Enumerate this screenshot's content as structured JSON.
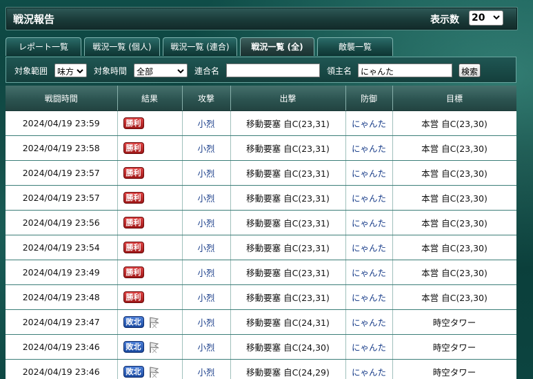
{
  "header": {
    "title": "戦況報告",
    "count_label": "表示数",
    "count_value": "20"
  },
  "tabs": [
    {
      "label": "レポート一覧",
      "active": false
    },
    {
      "label": "戦況一覧 (個人)",
      "active": false
    },
    {
      "label": "戦況一覧 (連合)",
      "active": false
    },
    {
      "label": "戦況一覧 (全)",
      "active": true
    },
    {
      "label": "敵襲一覧",
      "active": false
    }
  ],
  "filter": {
    "range_label": "対象範囲",
    "range_value": "味方",
    "time_label": "対象時間",
    "time_value": "全部",
    "alliance_label": "連合名",
    "alliance_value": "",
    "lord_label": "領主名",
    "lord_value": "にゃんた",
    "search_label": "検索"
  },
  "columns": [
    "戦闘時間",
    "結果",
    "攻撃",
    "出撃",
    "防御",
    "目標"
  ],
  "rows": [
    {
      "time": "2024/04/19 23:59",
      "result": "勝利",
      "attack": "小烈",
      "sortie": "移動要塞 自C(23,31)",
      "defense": "にゃんた",
      "target": "本営 自C(23,30)"
    },
    {
      "time": "2024/04/19 23:58",
      "result": "勝利",
      "attack": "小烈",
      "sortie": "移動要塞 自C(23,31)",
      "defense": "にゃんた",
      "target": "本営 自C(23,30)"
    },
    {
      "time": "2024/04/19 23:57",
      "result": "勝利",
      "attack": "小烈",
      "sortie": "移動要塞 自C(23,31)",
      "defense": "にゃんた",
      "target": "本営 自C(23,30)"
    },
    {
      "time": "2024/04/19 23:57",
      "result": "勝利",
      "attack": "小烈",
      "sortie": "移動要塞 自C(23,31)",
      "defense": "にゃんた",
      "target": "本営 自C(23,30)"
    },
    {
      "time": "2024/04/19 23:56",
      "result": "勝利",
      "attack": "小烈",
      "sortie": "移動要塞 自C(23,31)",
      "defense": "にゃんた",
      "target": "本営 自C(23,30)"
    },
    {
      "time": "2024/04/19 23:54",
      "result": "勝利",
      "attack": "小烈",
      "sortie": "移動要塞 自C(23,31)",
      "defense": "にゃんた",
      "target": "本営 自C(23,30)"
    },
    {
      "time": "2024/04/19 23:49",
      "result": "勝利",
      "attack": "小烈",
      "sortie": "移動要塞 自C(23,31)",
      "defense": "にゃんた",
      "target": "本営 自C(23,30)"
    },
    {
      "time": "2024/04/19 23:48",
      "result": "勝利",
      "attack": "小烈",
      "sortie": "移動要塞 自C(23,31)",
      "defense": "にゃんた",
      "target": "本営 自C(23,30)"
    },
    {
      "time": "2024/04/19 23:47",
      "result": "敗北",
      "attack": "小烈",
      "sortie": "移動要塞 自C(24,31)",
      "defense": "にゃんた",
      "target": "時空タワー"
    },
    {
      "time": "2024/04/19 23:46",
      "result": "敗北",
      "attack": "小烈",
      "sortie": "移動要塞 自C(24,30)",
      "defense": "にゃんた",
      "target": "時空タワー"
    },
    {
      "time": "2024/04/19 23:46",
      "result": "敗北",
      "attack": "小烈",
      "sortie": "移動要塞 自C(24,29)",
      "defense": "にゃんた",
      "target": "時空タワー"
    }
  ],
  "colors": {
    "win": "#c02020",
    "lose": "#2a5ab8",
    "link": "#1a3e8a"
  },
  "icons": {
    "lose_icon": "flag-icon",
    "select_icon": "chevron-down-icon"
  }
}
